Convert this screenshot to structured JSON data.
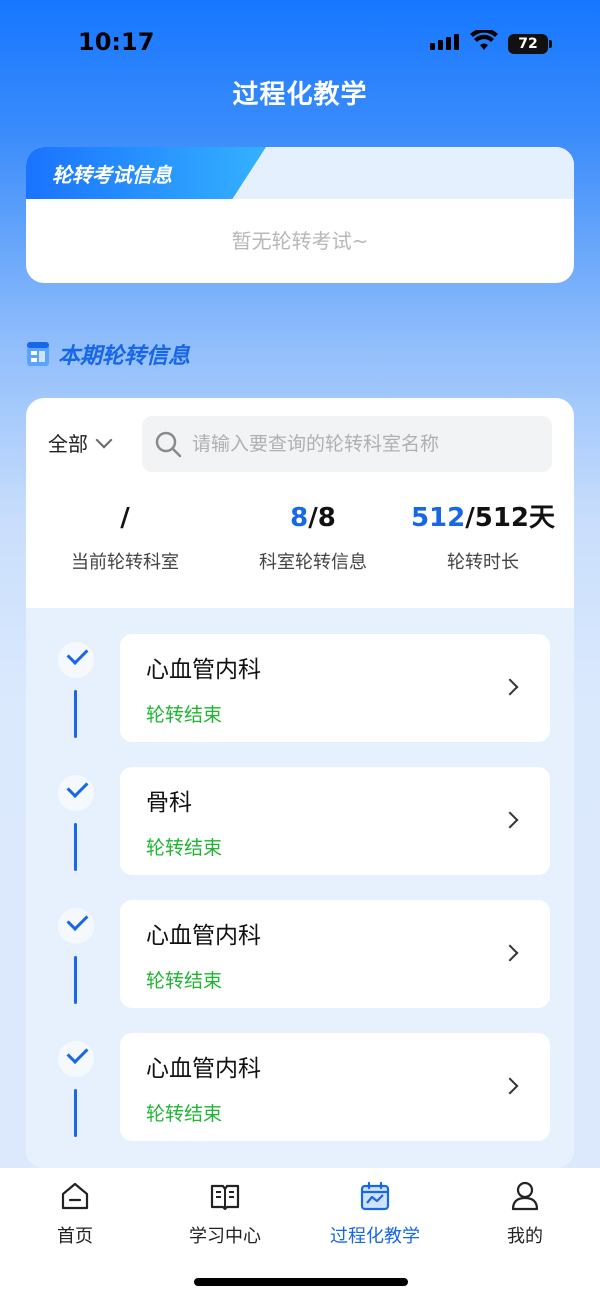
{
  "status_bar": {
    "time": "10:17",
    "battery": "72"
  },
  "page_title": "过程化教学",
  "exam_card": {
    "tab_label": "轮转考试信息",
    "empty_text": "暂无轮转考试~"
  },
  "section": {
    "title": "本期轮转信息"
  },
  "filter": {
    "selected": "全部",
    "search_placeholder": "请输入要查询的轮转科室名称",
    "search_value": ""
  },
  "stats": {
    "current_dept": {
      "value": "/",
      "label": "当前轮转科室"
    },
    "dept_info": {
      "done": "8",
      "sep_total": "/8",
      "label": "科室轮转信息"
    },
    "duration": {
      "done": "512",
      "sep_total": "/512天",
      "label": "轮转时长"
    }
  },
  "rotations": [
    {
      "name": "心血管内科",
      "status": "轮转结束"
    },
    {
      "name": "骨科",
      "status": "轮转结束"
    },
    {
      "name": "心血管内科",
      "status": "轮转结束"
    },
    {
      "name": "心血管内科",
      "status": "轮转结束"
    }
  ],
  "tabs": [
    {
      "label": "首页",
      "icon": "home-icon"
    },
    {
      "label": "学习中心",
      "icon": "book-icon"
    },
    {
      "label": "过程化教学",
      "icon": "calendar-chart-icon"
    },
    {
      "label": "我的",
      "icon": "user-icon"
    }
  ],
  "colors": {
    "accent": "#1767e6",
    "success": "#1fb533"
  }
}
